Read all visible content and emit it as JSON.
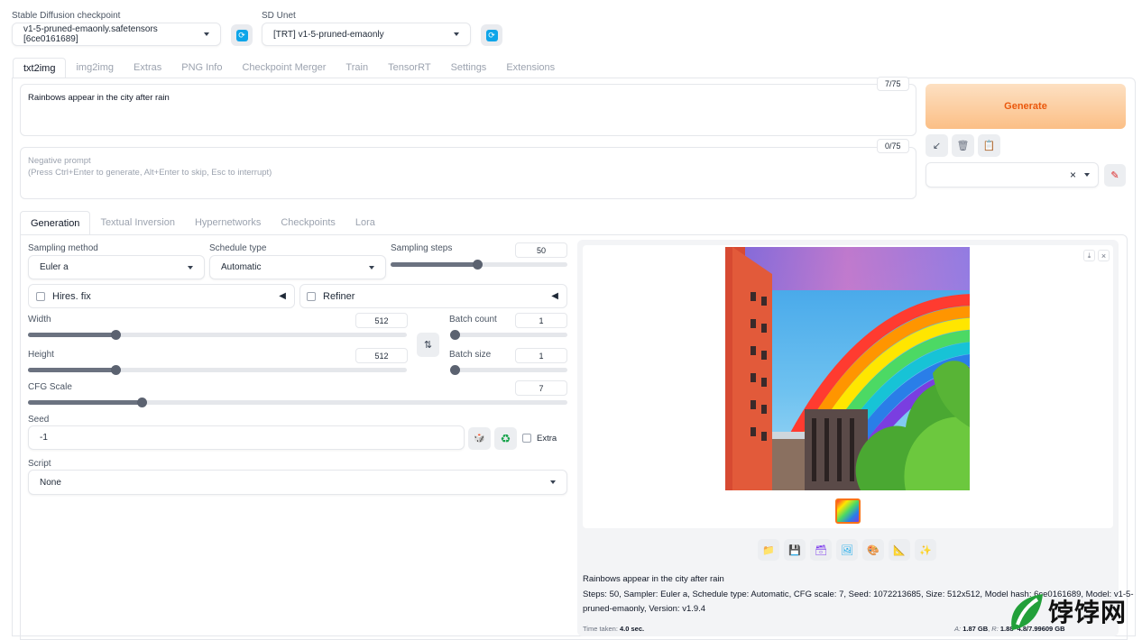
{
  "checkpoint": {
    "label": "Stable Diffusion checkpoint",
    "value": "v1-5-pruned-emaonly.safetensors [6ce0161689]"
  },
  "unet": {
    "label": "SD Unet",
    "value": "[TRT] v1-5-pruned-emaonly"
  },
  "tabs": [
    "txt2img",
    "img2img",
    "Extras",
    "PNG Info",
    "Checkpoint Merger",
    "Train",
    "TensorRT",
    "Settings",
    "Extensions"
  ],
  "prompt": {
    "value": "Rainbows appear in the city after rain",
    "counter": "7/75"
  },
  "negative": {
    "placeholder_line1": "Negative prompt",
    "placeholder_line2": "(Press Ctrl+Enter to generate, Alt+Enter to skip, Esc to interrupt)",
    "counter": "0/75"
  },
  "generate_label": "Generate",
  "style_clear": "×",
  "subtabs": [
    "Generation",
    "Textual Inversion",
    "Hypernetworks",
    "Checkpoints",
    "Lora"
  ],
  "sampling_method": {
    "label": "Sampling method",
    "value": "Euler a"
  },
  "schedule_type": {
    "label": "Schedule type",
    "value": "Automatic"
  },
  "sampling_steps": {
    "label": "Sampling steps",
    "value": "50",
    "fraction": 0.49
  },
  "hires": {
    "label": "Hires. fix"
  },
  "refiner": {
    "label": "Refiner"
  },
  "width": {
    "label": "Width",
    "value": "512",
    "fraction": 0.23
  },
  "height": {
    "label": "Height",
    "value": "512",
    "fraction": 0.23
  },
  "batch_count": {
    "label": "Batch count",
    "value": "1",
    "fraction": 0.0
  },
  "batch_size": {
    "label": "Batch size",
    "value": "1",
    "fraction": 0.0
  },
  "cfg_scale": {
    "label": "CFG Scale",
    "value": "7",
    "fraction": 0.21
  },
  "seed": {
    "label": "Seed",
    "value": "-1",
    "extra_label": "Extra"
  },
  "script": {
    "label": "Script",
    "value": "None"
  },
  "output": {
    "prompt_text": "Rainbows appear in the city after rain",
    "params_line1": "Steps: 50, Sampler: Euler a, Schedule type: Automatic, CFG scale: 7, Seed: 1072213685, Size: 512x512, Model hash: 6ce0161689, Model: v1-5-",
    "params_line2": "pruned-emaonly, Version: v1.9.4",
    "time_label": "Time taken:",
    "time_value": "4.0 sec.",
    "vram_a": "1.87 GB",
    "vram_b": "1.88",
    "vram_c": "4.8/7.99609 GB"
  },
  "watermark": {
    "text": "饽饽网"
  },
  "colors": {
    "generate_top": "#fdd9b5",
    "generate_bottom": "#fbbf86",
    "generate_text": "#ea580c",
    "accent_blue": "#0ea5e9"
  }
}
